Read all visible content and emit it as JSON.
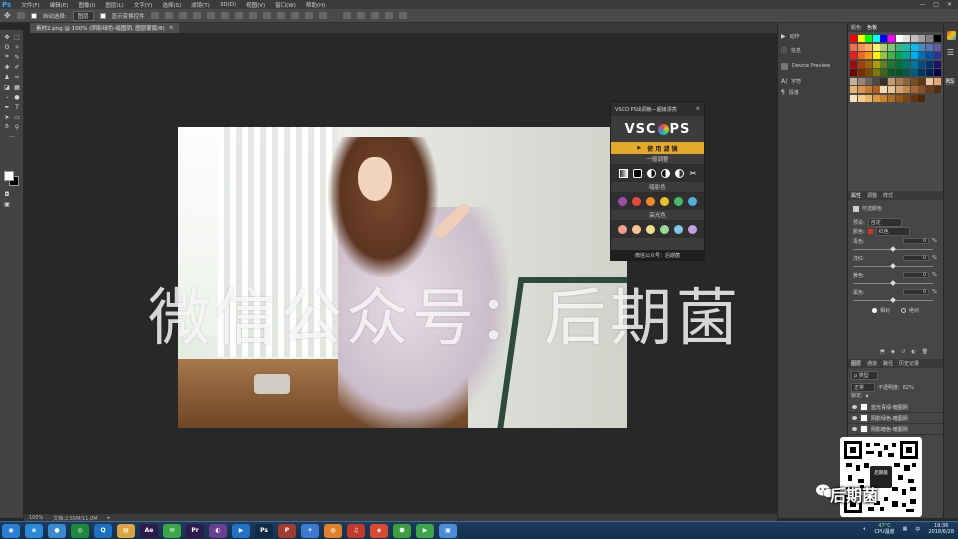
{
  "app": {
    "logo": "Ps"
  },
  "menubar": {
    "items": [
      "文件(F)",
      "编辑(E)",
      "图像(I)",
      "图层(L)",
      "文字(Y)",
      "选择(S)",
      "滤镜(T)",
      "3D(D)",
      "视图(V)",
      "窗口(W)",
      "帮助(H)"
    ],
    "minimize": "—",
    "restore": "□",
    "close": "✕"
  },
  "options": {
    "auto_select_label": "自动选择:",
    "auto_select_value": "图层",
    "transform_label": "显示变换控件"
  },
  "document": {
    "tab_title": "素材2.png @ 100% (阴影绿色-暗图阴, 图层蒙版/8)",
    "tab_close": "×"
  },
  "statusbar": {
    "zoom": "100%",
    "doc_info": "文档:2.55M/11.0M"
  },
  "watermark": "微信公众号：后期菌",
  "vsco_panel": {
    "title": "VSCO PS出调板—超级漂亮",
    "close": "×",
    "logo_left": "VSC",
    "logo_right": "PS",
    "apply_label": "使 用 滤 镜",
    "section_general": "一般调整",
    "section_shadow": "暗影色",
    "section_highlight": "高光色",
    "footer": "微信公众号：后期菌",
    "shadow_colors": [
      "#9b4ea8",
      "#e44b3b",
      "#ef8a2a",
      "#e9c02a",
      "#4ab86a",
      "#4fb0d8"
    ],
    "highlight_colors": [
      "#f2a08d",
      "#f5c48f",
      "#efe08a",
      "#9fd89b",
      "#7fc8e8",
      "#c3a0e0"
    ]
  },
  "mid_panel": {
    "items": [
      "动作",
      "信息",
      "Device Preview",
      "字符",
      "段落"
    ]
  },
  "swatch_panel": {
    "tabs": [
      "颜色",
      "色板"
    ]
  },
  "properties": {
    "tabs": [
      "属性",
      "调整",
      "样式"
    ],
    "title": "可选颜色",
    "preset_label": "预设:",
    "preset_value": "自定",
    "colors_label": "颜色:",
    "colors_value": "红色",
    "sliders": [
      {
        "label": "青色:",
        "value": "0",
        "unit": "%"
      },
      {
        "label": "洋红:",
        "value": "0",
        "unit": "%"
      },
      {
        "label": "黄色:",
        "value": "0",
        "unit": "%"
      },
      {
        "label": "黑色:",
        "value": "0",
        "unit": "%"
      }
    ],
    "relative": "相对",
    "absolute": "绝对"
  },
  "layers_panel": {
    "tabs": [
      "图层",
      "通道",
      "路径",
      "历史记录"
    ],
    "kind": "ρ 类型",
    "blend": "正常",
    "opacity_label": "不透明度:",
    "opacity_value": "82%",
    "fill_label": "锁定:",
    "layers": [
      "蓝光青绿-暗图阴",
      "阴影绿色-暗图阴",
      "阴影暗色-暗图阴"
    ]
  },
  "qr": {
    "brand": "后期菌",
    "center": "后期菌"
  },
  "taskbar": {
    "icons": [
      {
        "name": "start-orb-icon",
        "color": "#2a7fd4",
        "glyph": "◉"
      },
      {
        "name": "ie-icon",
        "color": "#2a8ad8",
        "glyph": "e"
      },
      {
        "name": "people-icon",
        "color": "#3b8ad0",
        "glyph": "●"
      },
      {
        "name": "chrome-icon",
        "color": "#1b8a3a",
        "glyph": "◎"
      },
      {
        "name": "qq-icon",
        "color": "#1d6fbf",
        "glyph": "Q"
      },
      {
        "name": "folder-icon",
        "color": "#d9a441",
        "glyph": "▤"
      },
      {
        "name": "after-effects-icon",
        "color": "#2b1a4a",
        "glyph": "Ae"
      },
      {
        "name": "wechat-icon",
        "color": "#3aa647",
        "glyph": "✉"
      },
      {
        "name": "premiere-icon",
        "color": "#2b1a4a",
        "glyph": "Pr"
      },
      {
        "name": "lightroom-icon",
        "color": "#6a3e90",
        "glyph": "◐"
      },
      {
        "name": "media-icon",
        "color": "#2072c4",
        "glyph": "▶"
      },
      {
        "name": "photoshop-icon",
        "color": "#0f2a44",
        "glyph": "Ps"
      },
      {
        "name": "ppt-icon",
        "color": "#a13c2e",
        "glyph": "P"
      },
      {
        "name": "flash-icon",
        "color": "#3b7ad0",
        "glyph": "✈"
      },
      {
        "name": "capture-icon",
        "color": "#e0802a",
        "glyph": "◍"
      },
      {
        "name": "netease-icon",
        "color": "#c23a2a",
        "glyph": "♫"
      },
      {
        "name": "browser-icon",
        "color": "#d84a30",
        "glyph": "◈"
      },
      {
        "name": "security-icon",
        "color": "#3d9f3d",
        "glyph": "⬢"
      },
      {
        "name": "player-icon",
        "color": "#3ca54a",
        "glyph": "▶"
      },
      {
        "name": "monitor-icon",
        "color": "#4a8fd6",
        "glyph": "▣"
      }
    ],
    "temp": "47°C",
    "cpu": "CPU温度",
    "time": "19:36",
    "date": "2018/6/28"
  }
}
